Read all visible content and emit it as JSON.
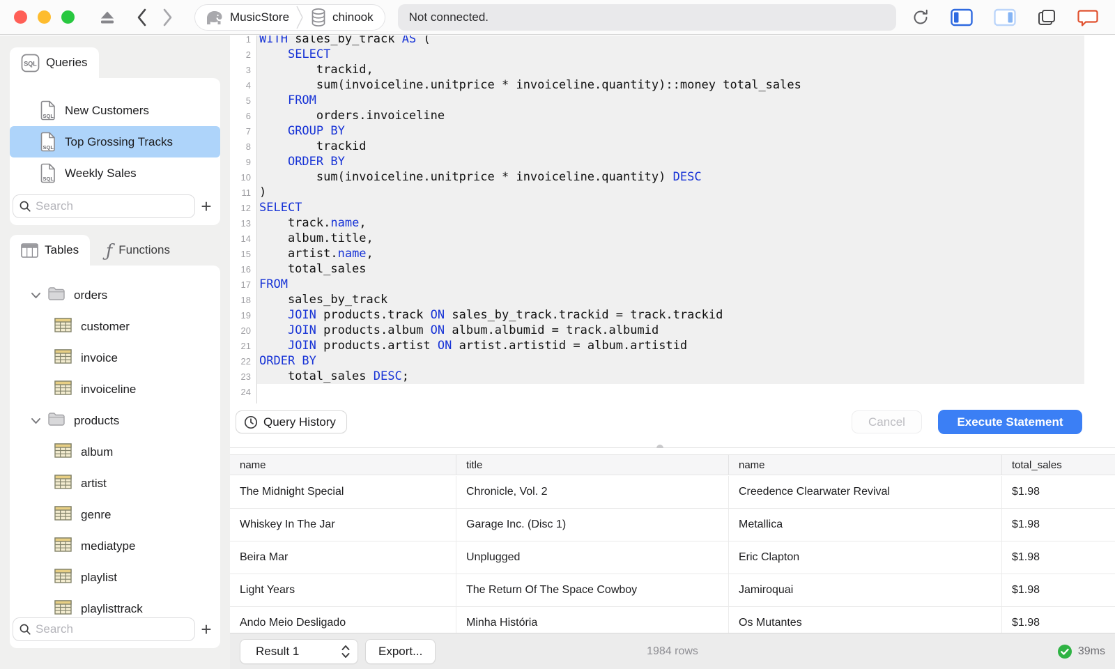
{
  "colors": {
    "accent": "#3b7ff5",
    "keyword": "#1733d6",
    "selection": "#aed4fa",
    "success": "#2fb344",
    "feedback_bubble": "#e0502e"
  },
  "toolbar": {
    "breadcrumb": {
      "server": "MusicStore",
      "database": "chinook"
    },
    "status": "Not connected."
  },
  "sidebar": {
    "queries": {
      "tab_label": "Queries",
      "items": [
        {
          "label": "New Customers",
          "selected": false
        },
        {
          "label": "Top Grossing Tracks",
          "selected": true
        },
        {
          "label": "Weekly Sales",
          "selected": false
        }
      ],
      "search_placeholder": "Search",
      "add_label": "+"
    },
    "schema": {
      "tabs": [
        {
          "label": "Tables"
        },
        {
          "label": "Functions"
        }
      ],
      "tree": [
        {
          "type": "folder",
          "label": "orders",
          "expanded": true
        },
        {
          "type": "table",
          "label": "customer"
        },
        {
          "type": "table",
          "label": "invoice"
        },
        {
          "type": "table",
          "label": "invoiceline"
        },
        {
          "type": "folder",
          "label": "products",
          "expanded": true
        },
        {
          "type": "table",
          "label": "album"
        },
        {
          "type": "table",
          "label": "artist"
        },
        {
          "type": "table",
          "label": "genre"
        },
        {
          "type": "table",
          "label": "mediatype"
        },
        {
          "type": "table",
          "label": "playlist"
        },
        {
          "type": "table",
          "label": "playlisttrack"
        }
      ],
      "search_placeholder": "Search",
      "add_label": "+"
    }
  },
  "editor": {
    "query_history_label": "Query History",
    "cancel_label": "Cancel",
    "execute_label": "Execute Statement",
    "lines": [
      {
        "n": 1,
        "segs": [
          [
            "WITH",
            1
          ],
          [
            " sales_by_track ",
            0
          ],
          [
            "AS",
            1
          ],
          [
            " (",
            0
          ]
        ]
      },
      {
        "n": 2,
        "segs": [
          [
            "    ",
            0
          ],
          [
            "SELECT",
            1
          ]
        ]
      },
      {
        "n": 3,
        "segs": [
          [
            "        trackid,",
            0
          ]
        ]
      },
      {
        "n": 4,
        "segs": [
          [
            "        sum(invoiceline.unitprice * invoiceline.quantity)::money total_sales",
            0
          ]
        ]
      },
      {
        "n": 5,
        "segs": [
          [
            "    ",
            0
          ],
          [
            "FROM",
            1
          ]
        ]
      },
      {
        "n": 6,
        "segs": [
          [
            "        orders.invoiceline",
            0
          ]
        ]
      },
      {
        "n": 7,
        "segs": [
          [
            "    ",
            0
          ],
          [
            "GROUP BY",
            1
          ]
        ]
      },
      {
        "n": 8,
        "segs": [
          [
            "        trackid",
            0
          ]
        ]
      },
      {
        "n": 9,
        "segs": [
          [
            "    ",
            0
          ],
          [
            "ORDER BY",
            1
          ]
        ]
      },
      {
        "n": 10,
        "segs": [
          [
            "        sum(invoiceline.unitprice * invoiceline.quantity) ",
            0
          ],
          [
            "DESC",
            1
          ]
        ]
      },
      {
        "n": 11,
        "segs": [
          [
            ")",
            0
          ]
        ]
      },
      {
        "n": 12,
        "segs": [
          [
            "SELECT",
            1
          ]
        ]
      },
      {
        "n": 13,
        "segs": [
          [
            "    track.",
            0
          ],
          [
            "name",
            1
          ],
          [
            ",",
            0
          ]
        ]
      },
      {
        "n": 14,
        "segs": [
          [
            "    album.title,",
            0
          ]
        ]
      },
      {
        "n": 15,
        "segs": [
          [
            "    artist.",
            0
          ],
          [
            "name",
            1
          ],
          [
            ",",
            0
          ]
        ]
      },
      {
        "n": 16,
        "segs": [
          [
            "    total_sales",
            0
          ]
        ]
      },
      {
        "n": 17,
        "segs": [
          [
            "FROM",
            1
          ]
        ]
      },
      {
        "n": 18,
        "segs": [
          [
            "    sales_by_track",
            0
          ]
        ]
      },
      {
        "n": 19,
        "segs": [
          [
            "    ",
            0
          ],
          [
            "JOIN",
            1
          ],
          [
            " products.track ",
            0
          ],
          [
            "ON",
            1
          ],
          [
            " sales_by_track.trackid = track.trackid",
            0
          ]
        ]
      },
      {
        "n": 20,
        "segs": [
          [
            "    ",
            0
          ],
          [
            "JOIN",
            1
          ],
          [
            " products.album ",
            0
          ],
          [
            "ON",
            1
          ],
          [
            " album.albumid = track.albumid",
            0
          ]
        ]
      },
      {
        "n": 21,
        "segs": [
          [
            "    ",
            0
          ],
          [
            "JOIN",
            1
          ],
          [
            " products.artist ",
            0
          ],
          [
            "ON",
            1
          ],
          [
            " artist.artistid = album.artistid",
            0
          ]
        ]
      },
      {
        "n": 22,
        "segs": [
          [
            "ORDER BY",
            1
          ]
        ]
      },
      {
        "n": 23,
        "segs": [
          [
            "    total_sales ",
            0
          ],
          [
            "DESC",
            1
          ],
          [
            ";",
            0
          ]
        ]
      },
      {
        "n": 24,
        "segs": []
      }
    ]
  },
  "results": {
    "columns": [
      "name",
      "title",
      "name",
      "total_sales"
    ],
    "rows": [
      [
        "The Midnight Special",
        "Chronicle, Vol. 2",
        "Creedence Clearwater Revival",
        "$1.98"
      ],
      [
        "Whiskey In The Jar",
        "Garage Inc. (Disc 1)",
        "Metallica",
        "$1.98"
      ],
      [
        "Beira Mar",
        "Unplugged",
        "Eric Clapton",
        "$1.98"
      ],
      [
        "Light Years",
        "The Return Of The Space Cowboy",
        "Jamiroquai",
        "$1.98"
      ],
      [
        "Ando Meio Desligado",
        "Minha História",
        "Os Mutantes",
        "$1.98"
      ]
    ],
    "result_selector": "Result 1",
    "export_label": "Export...",
    "row_count": "1984 rows",
    "duration": "39ms"
  }
}
